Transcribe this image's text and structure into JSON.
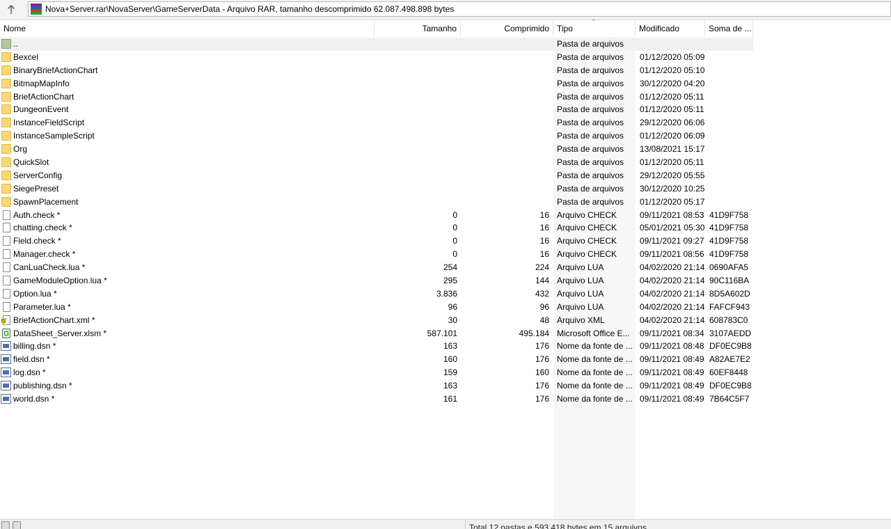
{
  "address_bar": {
    "path": "Nova+Server.rar\\NovaServer\\GameServerData - Arquivo RAR, tamanho descomprimido 62.087.498.898 bytes"
  },
  "columns": {
    "name": "Nome",
    "size": "Tamanho",
    "compressed": "Comprimido",
    "type": "Tipo",
    "modified": "Modificado",
    "checksum": "Soma de ..."
  },
  "rows": [
    {
      "icon": "up-folder-icon",
      "name": "..",
      "size": "",
      "compressed": "",
      "type": "Pasta de arquivos",
      "modified": "",
      "crc": ""
    },
    {
      "icon": "folder-icon",
      "name": "Bexcel",
      "size": "",
      "compressed": "",
      "type": "Pasta de arquivos",
      "modified": "01/12/2020 05:09",
      "crc": ""
    },
    {
      "icon": "folder-icon",
      "name": "BinaryBriefActionChart",
      "size": "",
      "compressed": "",
      "type": "Pasta de arquivos",
      "modified": "01/12/2020 05:10",
      "crc": ""
    },
    {
      "icon": "folder-icon",
      "name": "BitmapMapInfo",
      "size": "",
      "compressed": "",
      "type": "Pasta de arquivos",
      "modified": "30/12/2020 04:20",
      "crc": ""
    },
    {
      "icon": "folder-icon",
      "name": "BriefActionChart",
      "size": "",
      "compressed": "",
      "type": "Pasta de arquivos",
      "modified": "01/12/2020 05:11",
      "crc": ""
    },
    {
      "icon": "folder-icon",
      "name": "DungeonEvent",
      "size": "",
      "compressed": "",
      "type": "Pasta de arquivos",
      "modified": "01/12/2020 05:11",
      "crc": ""
    },
    {
      "icon": "folder-icon",
      "name": "InstanceFieldScript",
      "size": "",
      "compressed": "",
      "type": "Pasta de arquivos",
      "modified": "29/12/2020 06:06",
      "crc": ""
    },
    {
      "icon": "folder-icon",
      "name": "InstanceSampleScript",
      "size": "",
      "compressed": "",
      "type": "Pasta de arquivos",
      "modified": "01/12/2020 06:09",
      "crc": ""
    },
    {
      "icon": "folder-icon",
      "name": "Org",
      "size": "",
      "compressed": "",
      "type": "Pasta de arquivos",
      "modified": "13/08/2021 15:17",
      "crc": ""
    },
    {
      "icon": "folder-icon",
      "name": "QuickSlot",
      "size": "",
      "compressed": "",
      "type": "Pasta de arquivos",
      "modified": "01/12/2020 05:11",
      "crc": ""
    },
    {
      "icon": "folder-icon",
      "name": "ServerConfig",
      "size": "",
      "compressed": "",
      "type": "Pasta de arquivos",
      "modified": "29/12/2020 05:55",
      "crc": ""
    },
    {
      "icon": "folder-icon",
      "name": "SiegePreset",
      "size": "",
      "compressed": "",
      "type": "Pasta de arquivos",
      "modified": "30/12/2020 10:25",
      "crc": ""
    },
    {
      "icon": "folder-icon",
      "name": "SpawnPlacement",
      "size": "",
      "compressed": "",
      "type": "Pasta de arquivos",
      "modified": "01/12/2020 05:17",
      "crc": ""
    },
    {
      "icon": "file-icon",
      "name": "Auth.check *",
      "size": "0",
      "compressed": "16",
      "type": "Arquivo CHECK",
      "modified": "09/11/2021 08:53",
      "crc": "41D9F758"
    },
    {
      "icon": "file-icon",
      "name": "chatting.check *",
      "size": "0",
      "compressed": "16",
      "type": "Arquivo CHECK",
      "modified": "05/01/2021 05:30",
      "crc": "41D9F758"
    },
    {
      "icon": "file-icon",
      "name": "Field.check *",
      "size": "0",
      "compressed": "16",
      "type": "Arquivo CHECK",
      "modified": "09/11/2021 09:27",
      "crc": "41D9F758"
    },
    {
      "icon": "file-icon",
      "name": "Manager.check *",
      "size": "0",
      "compressed": "16",
      "type": "Arquivo CHECK",
      "modified": "09/11/2021 08:56",
      "crc": "41D9F758"
    },
    {
      "icon": "file-icon",
      "name": "CanLuaCheck.lua *",
      "size": "254",
      "compressed": "224",
      "type": "Arquivo LUA",
      "modified": "04/02/2020 21:14",
      "crc": "0690AFA5"
    },
    {
      "icon": "file-icon",
      "name": "GameModuleOption.lua *",
      "size": "295",
      "compressed": "144",
      "type": "Arquivo LUA",
      "modified": "04/02/2020 21:14",
      "crc": "90C116BA"
    },
    {
      "icon": "file-icon",
      "name": "Option.lua *",
      "size": "3.836",
      "compressed": "432",
      "type": "Arquivo LUA",
      "modified": "04/02/2020 21:14",
      "crc": "8D5A602D"
    },
    {
      "icon": "file-icon",
      "name": "Parameter.lua *",
      "size": "96",
      "compressed": "96",
      "type": "Arquivo LUA",
      "modified": "04/02/2020 21:14",
      "crc": "FAFCF943"
    },
    {
      "icon": "xml-file-icon",
      "name": "BriefActionChart.xml *",
      "size": "30",
      "compressed": "48",
      "type": "Arquivo XML",
      "modified": "04/02/2020 21:14",
      "crc": "608783C0"
    },
    {
      "icon": "excel-file-icon",
      "name": "DataSheet_Server.xlsm *",
      "size": "587.101",
      "compressed": "495.184",
      "type": "Microsoft Office E...",
      "modified": "09/11/2021 08:34",
      "crc": "3107AEDD"
    },
    {
      "icon": "dsn-file-icon",
      "name": "billing.dsn *",
      "size": "163",
      "compressed": "176",
      "type": "Nome da fonte de ...",
      "modified": "09/11/2021 08:48",
      "crc": "DF0EC9B8"
    },
    {
      "icon": "dsn-file-icon",
      "name": "field.dsn *",
      "size": "160",
      "compressed": "176",
      "type": "Nome da fonte de ...",
      "modified": "09/11/2021 08:49",
      "crc": "A82AE7E2"
    },
    {
      "icon": "dsn-file-icon",
      "name": "log.dsn *",
      "size": "159",
      "compressed": "160",
      "type": "Nome da fonte de ...",
      "modified": "09/11/2021 08:49",
      "crc": "60EF8448"
    },
    {
      "icon": "dsn-file-icon",
      "name": "publishing.dsn *",
      "size": "163",
      "compressed": "176",
      "type": "Nome da fonte de ...",
      "modified": "09/11/2021 08:49",
      "crc": "DF0EC9B8"
    },
    {
      "icon": "dsn-file-icon",
      "name": "world.dsn *",
      "size": "161",
      "compressed": "176",
      "type": "Nome da fonte de ...",
      "modified": "09/11/2021 08:49",
      "crc": "7B64C5F7"
    }
  ],
  "status_bar": {
    "summary": "Total 12 pastas e 593.418 bytes em 15 arquivos"
  }
}
